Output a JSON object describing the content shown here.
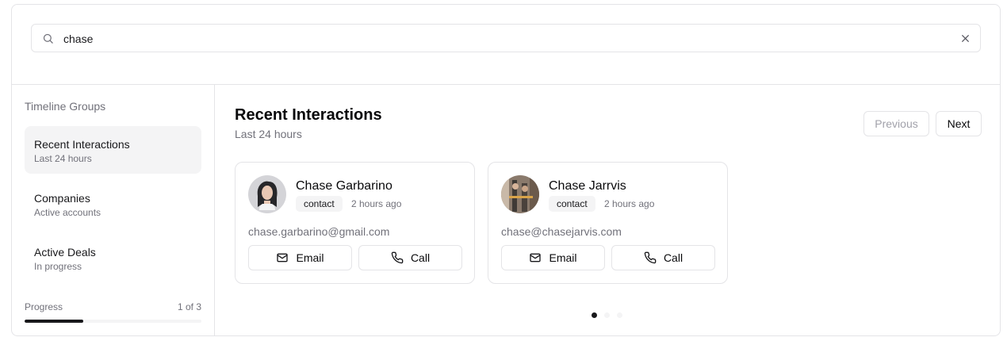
{
  "search": {
    "value": "chase",
    "icon": "search-icon",
    "clear_icon": "close-icon"
  },
  "sidebar": {
    "title": "Timeline Groups",
    "items": [
      {
        "label": "Recent Interactions",
        "sub": "Last 24 hours",
        "active": true
      },
      {
        "label": "Companies",
        "sub": "Active accounts",
        "active": false
      },
      {
        "label": "Active Deals",
        "sub": "In progress",
        "active": false
      }
    ],
    "progress": {
      "label": "Progress",
      "count": "1 of 3",
      "fraction": 0.333
    }
  },
  "main": {
    "title": "Recent Interactions",
    "subtitle": "Last 24 hours",
    "prev_label": "Previous",
    "next_label": "Next",
    "cards": [
      {
        "name": "Chase Garbarino",
        "badge": "contact",
        "time": "2 hours ago",
        "email": "chase.garbarino@gmail.com",
        "email_label": "Email",
        "call_label": "Call"
      },
      {
        "name": "Chase Jarrvis",
        "badge": "contact",
        "time": "2 hours ago",
        "email": "chase@chasejarvis.com",
        "email_label": "Email",
        "call_label": "Call"
      }
    ],
    "pagination": {
      "total": 3,
      "active": 0
    }
  },
  "colors": {
    "accent": "#18181b",
    "muted": "#71717a",
    "border": "#e4e4e7",
    "surface": "#f4f4f5"
  }
}
